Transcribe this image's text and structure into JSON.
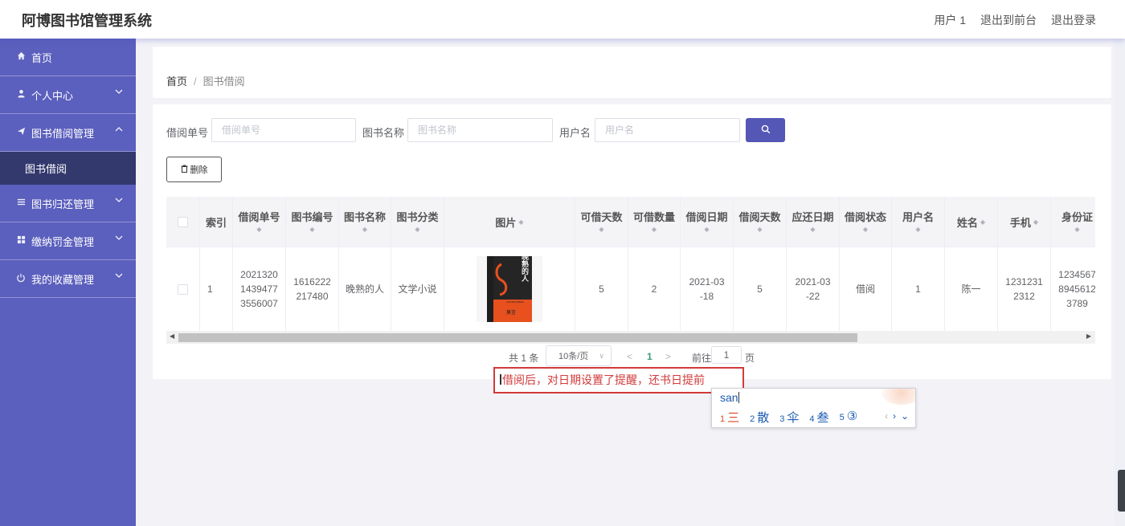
{
  "app": {
    "title": "阿博图书馆管理系统",
    "header_links": [
      "用户 1",
      "退出到前台",
      "退出登录"
    ]
  },
  "sidebar": {
    "items": [
      {
        "label": "首页",
        "icon": "home-icon",
        "expanded": false
      },
      {
        "label": "个人中心",
        "icon": "user-icon",
        "expanded": false
      },
      {
        "label": "图书借阅管理",
        "icon": "send-icon",
        "expanded": true
      },
      {
        "label": "图书归还管理",
        "icon": "list-icon",
        "expanded": false
      },
      {
        "label": "缴纳罚金管理",
        "icon": "grid-icon",
        "expanded": false
      },
      {
        "label": "我的收藏管理",
        "icon": "power-icon",
        "expanded": false
      }
    ],
    "sub_active": "图书借阅"
  },
  "breadcrumb": {
    "home": "首页",
    "sep": "/",
    "current": "图书借阅"
  },
  "search": {
    "fields": [
      {
        "label": "借阅单号",
        "placeholder": "借阅单号"
      },
      {
        "label": "图书名称",
        "placeholder": "图书名称"
      },
      {
        "label": "用户名",
        "placeholder": "用户名"
      }
    ],
    "button_icon": "search-icon"
  },
  "toolbar": {
    "delete_label": "删除",
    "delete_icon": "trash-icon"
  },
  "table": {
    "columns": [
      "索引",
      "借阅单号",
      "图书编号",
      "图书名称",
      "图书分类",
      "图片",
      "可借天数",
      "可借数量",
      "借阅日期",
      "借阅天数",
      "应还日期",
      "借阅状态",
      "用户名",
      "姓名",
      "手机",
      "身份证"
    ],
    "rows": [
      {
        "index": "1",
        "order_no": [
          "2021320",
          "1439477",
          "3556007"
        ],
        "book_no": [
          "1616222",
          "217480"
        ],
        "book_name": "晚熟的人",
        "category": "文学小说",
        "image_title": "晚熟的人",
        "image_sub": "LATE BLOOMERS",
        "image_author": "莫言",
        "days": "5",
        "quantity": "2",
        "borrow_date": [
          "2021-03",
          "-18"
        ],
        "borrow_days": "5",
        "due_date": [
          "2021-03",
          "-22"
        ],
        "status": "借阅",
        "username": "1",
        "name": "陈一",
        "phone": [
          "1231231",
          "2312"
        ],
        "id_card": [
          "1234567",
          "8945612",
          "3789"
        ]
      }
    ]
  },
  "pagination": {
    "total": "共 1 条",
    "page_size": "10条/页",
    "current_page": "1",
    "goto_label": "前往",
    "goto_value": "1",
    "page_suffix": "页"
  },
  "annotation": {
    "text": "借阅后，对日期设置了提醒，还书日提前"
  },
  "ime": {
    "composition": "san",
    "candidates": [
      {
        "n": "1",
        "text": "三"
      },
      {
        "n": "2",
        "text": "散"
      },
      {
        "n": "3",
        "text": "伞"
      },
      {
        "n": "4",
        "text": "叁"
      },
      {
        "n": "5",
        "text": "③"
      }
    ]
  },
  "colors": {
    "sidebar": "#5b5fbd",
    "sidebar_active": "#33386d",
    "primary_button": "#5457b5",
    "annotation": "#d23a3a",
    "ime_text": "#1a5ab0"
  }
}
